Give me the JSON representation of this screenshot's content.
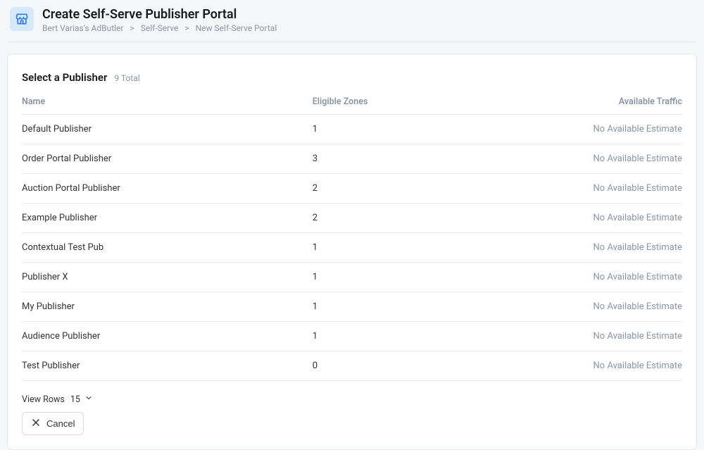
{
  "header": {
    "title": "Create Self-Serve Publisher Portal",
    "breadcrumb": [
      "Bert Varias's AdButler",
      "Self-Serve",
      "New Self-Serve Portal"
    ]
  },
  "section": {
    "title": "Select a Publisher",
    "total_label": "9 Total"
  },
  "columns": {
    "name": "Name",
    "zones": "Eligible Zones",
    "traffic": "Available Traffic"
  },
  "no_estimate": "No Available Estimate",
  "rows": [
    {
      "name": "Default Publisher",
      "zones": "1"
    },
    {
      "name": "Order Portal Publisher",
      "zones": "3"
    },
    {
      "name": "Auction Portal Publisher",
      "zones": "2"
    },
    {
      "name": "Example Publisher",
      "zones": "2"
    },
    {
      "name": "Contextual Test Pub",
      "zones": "1"
    },
    {
      "name": "Publisher X",
      "zones": "1"
    },
    {
      "name": "My Publisher",
      "zones": "1"
    },
    {
      "name": "Audience Publisher",
      "zones": "1"
    },
    {
      "name": "Test Publisher",
      "zones": "0"
    }
  ],
  "footer": {
    "view_rows_label": "View Rows",
    "view_rows_value": "15",
    "cancel_label": "Cancel"
  }
}
